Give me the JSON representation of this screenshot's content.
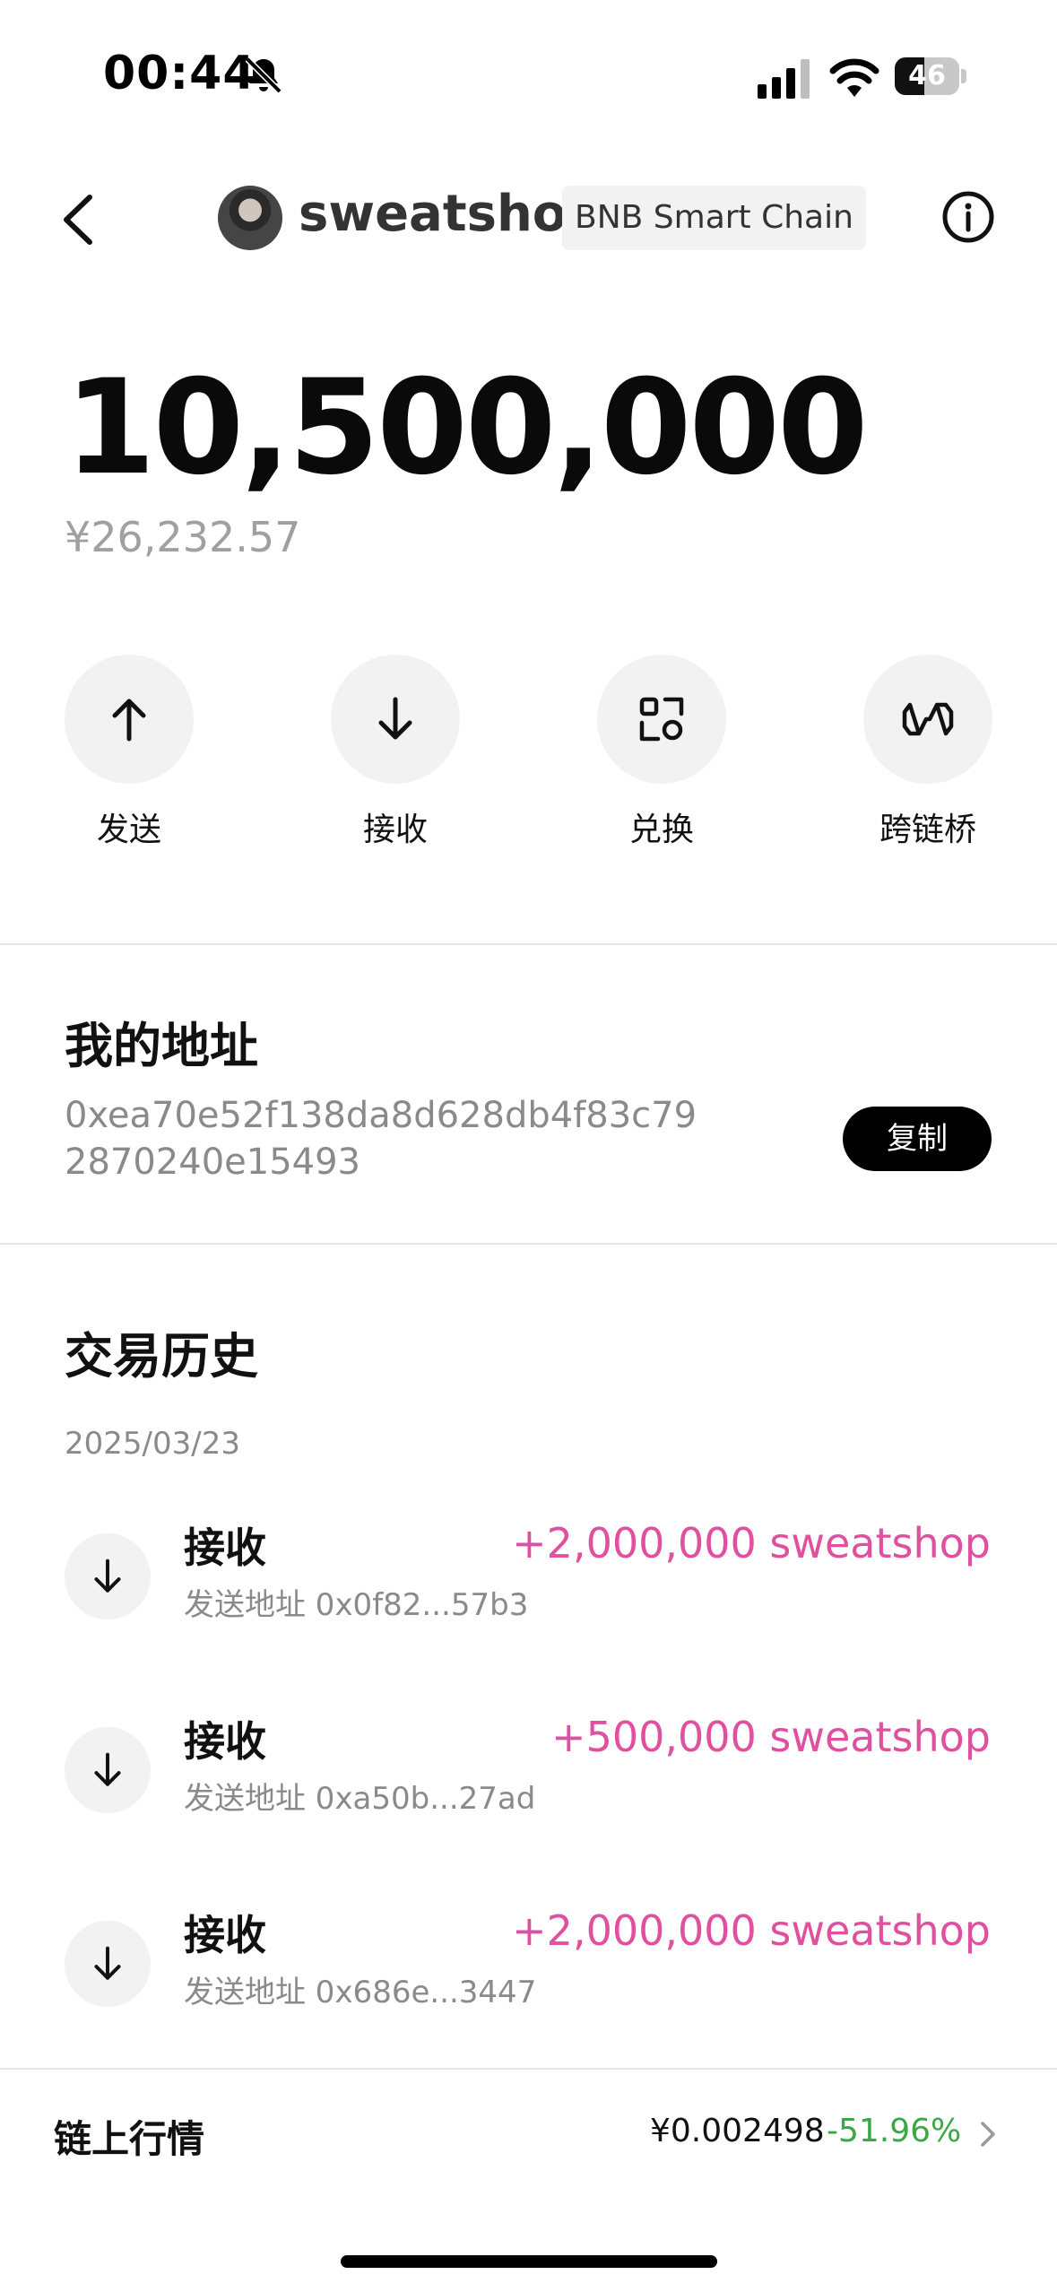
{
  "status_bar": {
    "time": "00:44",
    "battery": "46",
    "battery_level": 0.46,
    "icons": [
      "bell-slash-icon",
      "signal-icon",
      "wifi-icon",
      "battery-icon"
    ]
  },
  "header": {
    "token_name": "sweatshop",
    "chain": "BNB Smart Chain",
    "icons": [
      "chevron-left-icon",
      "info-icon"
    ]
  },
  "balance": {
    "amount": "10,500,000",
    "fiat": "¥26,232.57"
  },
  "actions": [
    {
      "label": "发送",
      "icon": "arrow-up-icon"
    },
    {
      "label": "接收",
      "icon": "arrow-down-icon"
    },
    {
      "label": "兑换",
      "icon": "swap-icon"
    },
    {
      "label": "跨链桥",
      "icon": "bridge-icon"
    }
  ],
  "address_section": {
    "title": "我的地址",
    "address": "0xea70e52f138da8d628db4f83c792870240e15493",
    "copy_label": "复制"
  },
  "history": {
    "title": "交易历史",
    "date": "2025/03/23",
    "items": [
      {
        "type": "接收",
        "from": "发送地址 0x0f82...57b3",
        "amount": "+2,000,000 sweatshop"
      },
      {
        "type": "接收",
        "from": "发送地址 0xa50b...27ad",
        "amount": "+500,000 sweatshop"
      },
      {
        "type": "接收",
        "from": "发送地址 0x686e...3447",
        "amount": "+2,000,000 sweatshop"
      }
    ]
  },
  "market": {
    "label": "链上行情",
    "price": "¥0.002498",
    "change": "-51.96%"
  },
  "colors": {
    "positive_amount": "#e0509e",
    "change_negative": "#3aa845",
    "button_bg": "#000000",
    "circle_bg": "#f2f2f2"
  }
}
